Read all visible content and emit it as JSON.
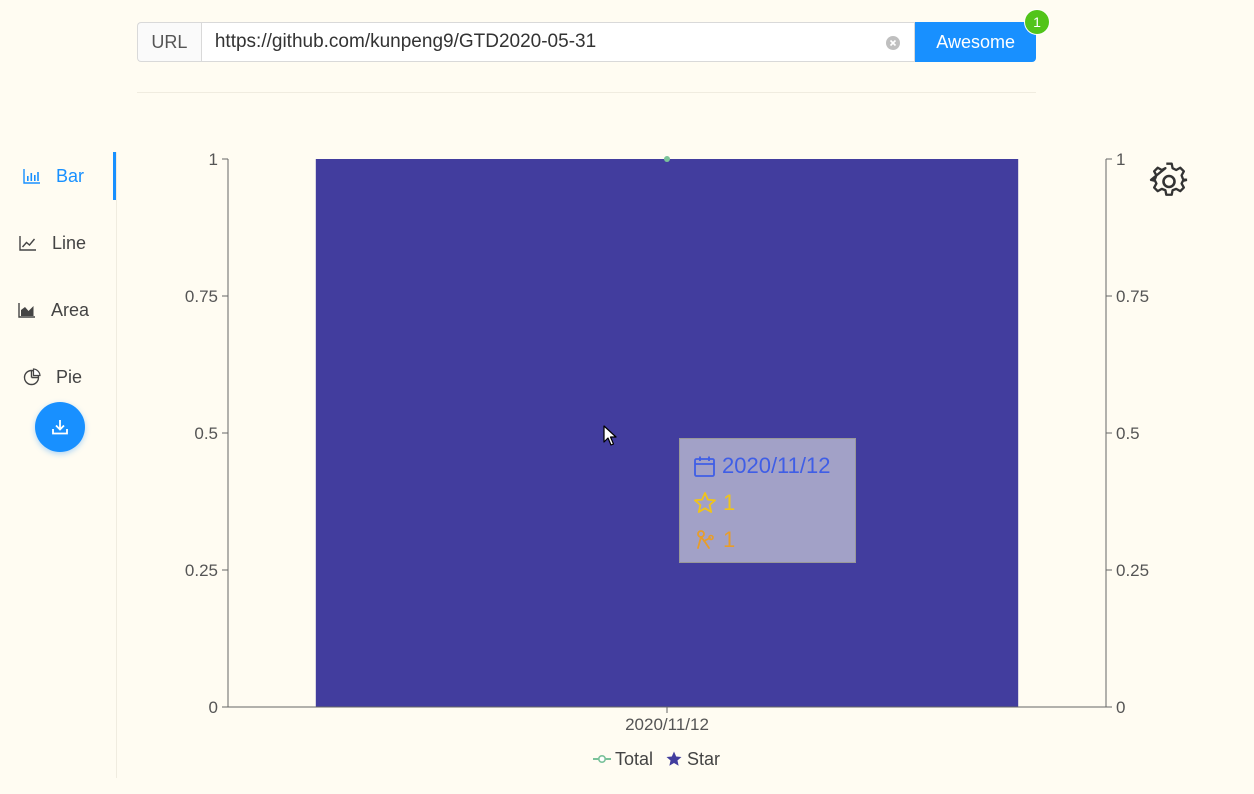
{
  "url_bar": {
    "addon_label": "URL",
    "value": "https://github.com/kunpeng9/GTD2020-05-31",
    "submit_label": "Awesome",
    "badge_count": "1"
  },
  "sidebar": {
    "items": [
      {
        "label": "Bar",
        "icon": "bar-chart-icon",
        "active": true
      },
      {
        "label": "Line",
        "icon": "line-chart-icon",
        "active": false
      },
      {
        "label": "Area",
        "icon": "area-chart-icon",
        "active": false
      },
      {
        "label": "Pie",
        "icon": "pie-chart-icon",
        "active": false
      }
    ],
    "download_icon": "download-icon"
  },
  "chart_data": {
    "type": "bar",
    "categories": [
      "2020/11/12"
    ],
    "series": [
      {
        "name": "Total",
        "kind": "line",
        "values": [
          1
        ],
        "color": "#7ac29a"
      },
      {
        "name": "Star",
        "kind": "bar",
        "values": [
          1
        ],
        "color": "#423d9e"
      }
    ],
    "ylim_left": [
      0,
      1
    ],
    "ylim_right": [
      0,
      1
    ],
    "yticks": [
      "0",
      "0.25",
      "0.5",
      "0.75",
      "1"
    ],
    "legend_position": "bottom-center",
    "grid": false
  },
  "tooltip": {
    "date": "2020/11/12",
    "star": "1",
    "fork": "1",
    "colors": {
      "date": "#3f5ee6",
      "star": "#f0c419",
      "fork": "#e89d2a"
    }
  },
  "legend": {
    "items": [
      {
        "label": "Total",
        "icon": "line-dot-icon",
        "color": "#7ac29a"
      },
      {
        "label": "Star",
        "icon": "star-icon",
        "color": "#423d9e"
      }
    ]
  },
  "colors": {
    "accent": "#1890ff",
    "badge": "#52c41a",
    "background": "#fffcf2"
  }
}
